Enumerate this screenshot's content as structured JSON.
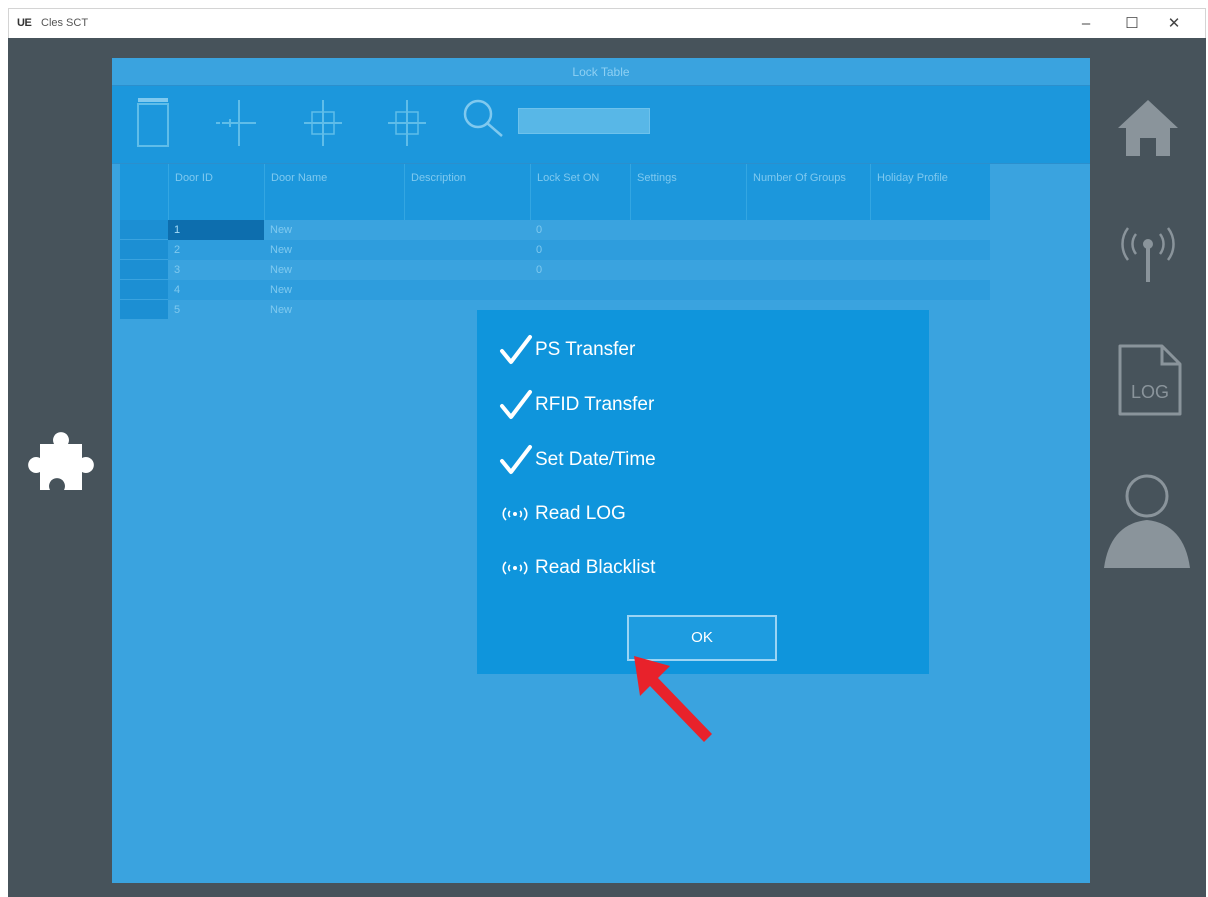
{
  "window": {
    "logo": "UE",
    "title": "Cles SCT",
    "minimize": "–",
    "maximize": "☐",
    "close": "✕"
  },
  "main": {
    "title": "Lock Table"
  },
  "toolbar": {
    "icons": [
      "new-document-icon",
      "add-link-icon",
      "add-node-icon",
      "remove-node-icon",
      "search-icon"
    ],
    "search_value": ""
  },
  "table": {
    "headers": [
      "Door ID",
      "Door Name",
      "Description",
      "Lock Set ON",
      "Settings",
      "Number Of Groups",
      "Holiday Profile"
    ],
    "rows": [
      {
        "id": "1",
        "name": "New",
        "lock": "0"
      },
      {
        "id": "2",
        "name": "New",
        "lock": "0"
      },
      {
        "id": "3",
        "name": "New",
        "lock": "0"
      },
      {
        "id": "4",
        "name": "New",
        "lock": ""
      },
      {
        "id": "5",
        "name": "New",
        "lock": ""
      }
    ]
  },
  "dialog": {
    "steps": [
      {
        "label": "PS Transfer",
        "state": "done",
        "icon": "check-icon"
      },
      {
        "label": "RFID Transfer",
        "state": "done",
        "icon": "check-icon"
      },
      {
        "label": "Set Date/Time",
        "state": "done",
        "icon": "check-icon"
      },
      {
        "label": "Read LOG",
        "state": "in-progress",
        "icon": "signal-icon"
      },
      {
        "label": "Read Blacklist",
        "state": "in-progress",
        "icon": "signal-icon"
      }
    ],
    "ok_label": "OK"
  },
  "rail": {
    "icons": [
      "home-icon",
      "antenna-icon",
      "log-file-icon",
      "user-icon"
    ],
    "log_text": "LOG"
  },
  "colors": {
    "panel": "#3aa3df",
    "dialog": "#0f95dc",
    "rail": "#47535b",
    "arrow": "#e8222b"
  }
}
